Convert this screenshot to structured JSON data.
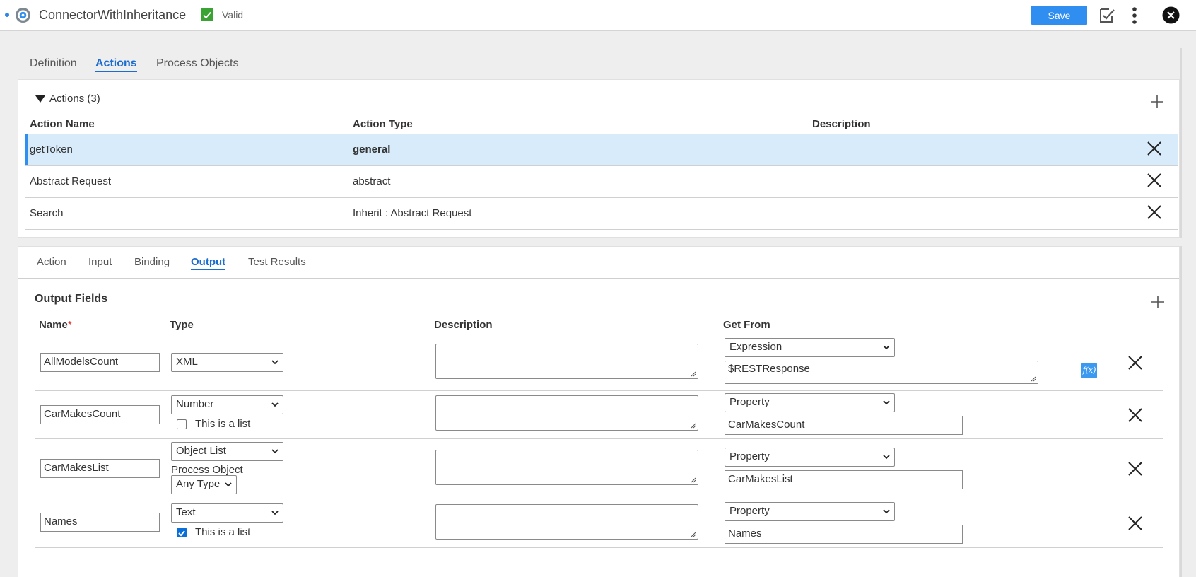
{
  "header": {
    "title": "ConnectorWithInheritance",
    "status": "Valid",
    "save_label": "Save"
  },
  "main_tabs": [
    {
      "label": "Definition",
      "active": false
    },
    {
      "label": "Actions",
      "active": true
    },
    {
      "label": "Process Objects",
      "active": false
    }
  ],
  "actions": {
    "section_label": "Actions (3)",
    "columns": [
      "Action Name",
      "Action Type",
      "Description"
    ],
    "rows": [
      {
        "name": "getToken",
        "type": "general",
        "description": "",
        "selected": true
      },
      {
        "name": "Abstract Request",
        "type": "abstract",
        "description": "",
        "selected": false
      },
      {
        "name": "Search",
        "type": "Inherit : Abstract Request",
        "description": "",
        "selected": false
      }
    ]
  },
  "detail_tabs": [
    {
      "label": "Action",
      "active": false
    },
    {
      "label": "Input",
      "active": false
    },
    {
      "label": "Binding",
      "active": false
    },
    {
      "label": "Output",
      "active": true
    },
    {
      "label": "Test Results",
      "active": false
    }
  ],
  "output": {
    "section_title": "Output Fields",
    "columns": {
      "name": "Name",
      "required_mark": "*",
      "type": "Type",
      "description": "Description",
      "get_from": "Get From"
    },
    "rows": [
      {
        "name": "AllModelsCount",
        "type": "XML",
        "description": "",
        "get_from": "Expression",
        "value": "$RESTResponse"
      },
      {
        "name": "CarMakesCount",
        "type": "Number",
        "list_label": "This is a list",
        "is_list": false,
        "description": "",
        "get_from": "Property",
        "value": "CarMakesCount"
      },
      {
        "name": "CarMakesList",
        "type": "Object List",
        "process_object_label": "Process Object",
        "process_object": "Any Type",
        "description": "",
        "get_from": "Property",
        "value": "CarMakesList"
      },
      {
        "name": "Names",
        "type": "Text",
        "list_label": "This is a list",
        "is_list": true,
        "description": "",
        "get_from": "Property",
        "value": "Names"
      }
    ]
  },
  "colors": {
    "accent": "#1c6dd0",
    "primary_button": "#2f8ef0",
    "selected_row": "#d8ebfa",
    "valid": "#3aa334"
  }
}
